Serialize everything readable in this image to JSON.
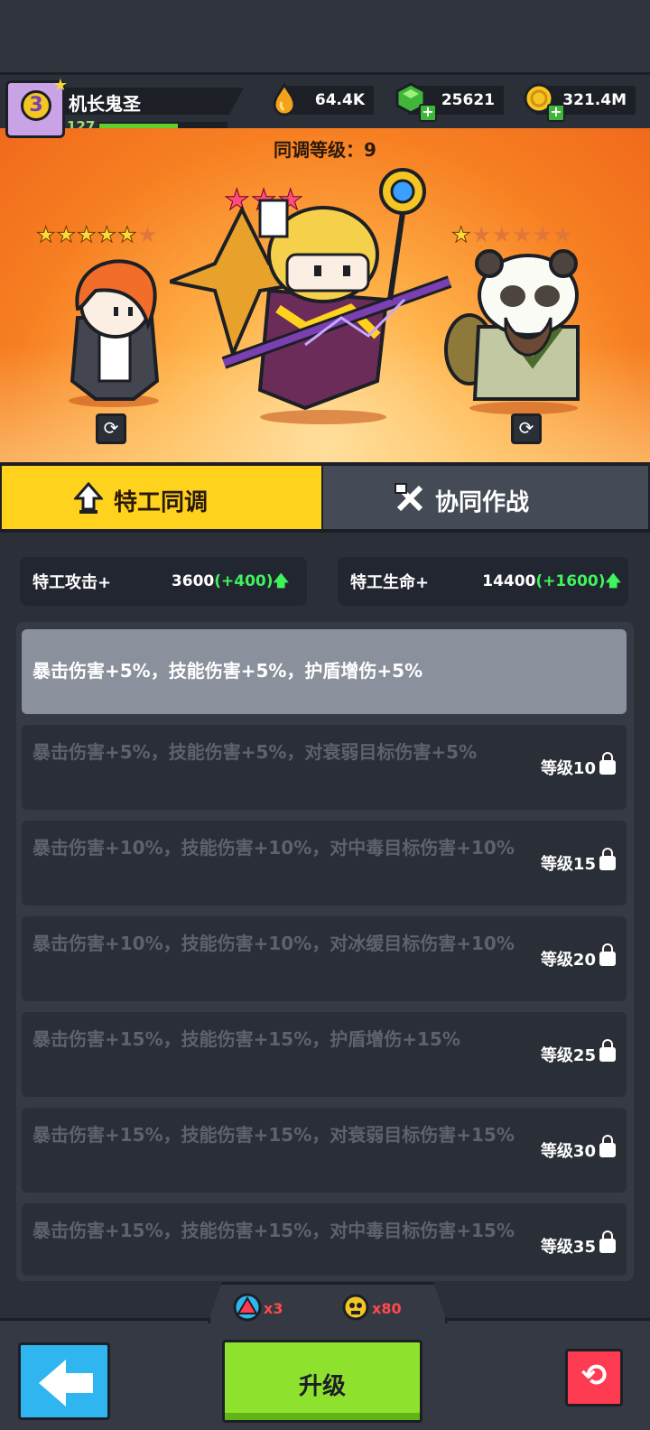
{
  "player": {
    "level": "3",
    "name": "机长鬼圣",
    "xp_level": "127",
    "xp_progress": 0.62
  },
  "resources": [
    {
      "icon": "flame-drop-icon",
      "value": "64.4K"
    },
    {
      "icon": "green-gem-icon",
      "value": "25621"
    },
    {
      "icon": "gold-coin-icon",
      "value": "321.4M"
    }
  ],
  "stage": {
    "sync_label": "同调等级：",
    "sync_level": "9",
    "left_stars": {
      "filled": 5,
      "total": 6
    },
    "center_stars": {
      "filled": 3,
      "total": 3
    },
    "right_stars": {
      "filled": 1,
      "total": 6
    }
  },
  "tabs": [
    {
      "label": "特工同调",
      "icon": "upgrade-arrow-icon",
      "active": true
    },
    {
      "label": "协同作战",
      "icon": "crossed-tools-icon",
      "active": false
    }
  ],
  "stats": [
    {
      "label": "特工攻击+",
      "value": "3600",
      "bonus": "(+400)"
    },
    {
      "label": "特工生命+",
      "value": "14400",
      "bonus": "(+1600)"
    }
  ],
  "bonuses": [
    {
      "text": "暴击伤害+5%，技能伤害+5%，护盾增伤+5%",
      "requirement": "",
      "unlocked": true
    },
    {
      "text": "暴击伤害+5%，技能伤害+5%，对衰弱目标伤害+5%",
      "requirement": "等级10",
      "unlocked": false
    },
    {
      "text": "暴击伤害+10%，技能伤害+10%，对中毒目标伤害+10%",
      "requirement": "等级15",
      "unlocked": false
    },
    {
      "text": "暴击伤害+10%，技能伤害+10%，对冰缓目标伤害+10%",
      "requirement": "等级20",
      "unlocked": false
    },
    {
      "text": "暴击伤害+15%，技能伤害+15%，护盾增伤+15%",
      "requirement": "等级25",
      "unlocked": false
    },
    {
      "text": "暴击伤害+15%，技能伤害+15%，对衰弱目标伤害+15%",
      "requirement": "等级30",
      "unlocked": false
    },
    {
      "text": "暴击伤害+15%，技能伤害+15%，对中毒目标伤害+15%",
      "requirement": "等级35",
      "unlocked": false
    }
  ],
  "costs": [
    {
      "icon": "red-gear-token-icon",
      "amount": "x3"
    },
    {
      "icon": "gold-skull-token-icon",
      "amount": "x80"
    }
  ],
  "buttons": {
    "back": "back-arrow-icon",
    "upgrade": "升级",
    "reset": "refresh-icon"
  },
  "colors": {
    "accent_yellow": "#ffd21e",
    "upgrade_green": "#8ee12c",
    "bonus_green": "#3ff35c"
  }
}
